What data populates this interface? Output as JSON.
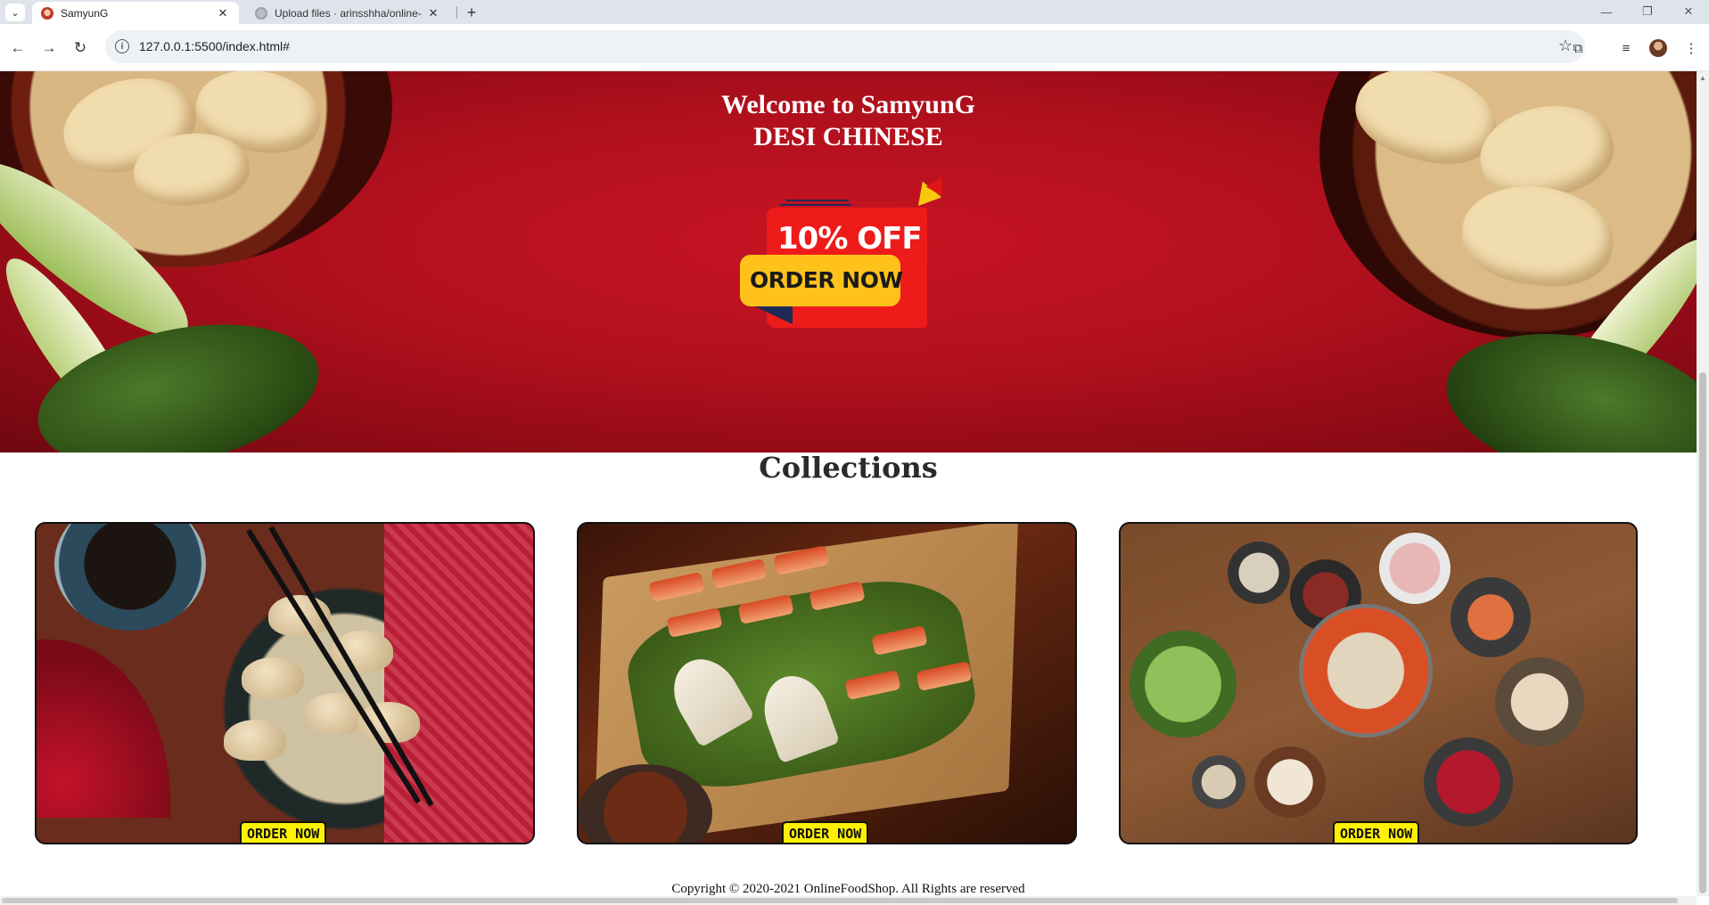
{
  "browser": {
    "tabs": [
      {
        "title": "SamyunG",
        "active": true
      },
      {
        "title": "Upload files · arinsshha/online-",
        "active": false
      }
    ],
    "url": "127.0.0.1:5500/index.html#"
  },
  "hero": {
    "line1": "Welcome to SamyunG",
    "line2": "DESI CHINESE",
    "promo_discount": "10% OFF",
    "promo_cta": "ORDER NOW"
  },
  "collections": {
    "title": "Collections",
    "cards": [
      {
        "dish_icon": "dumplings-image",
        "button_label": "ORDER NOW"
      },
      {
        "dish_icon": "peking-duck-image",
        "button_label": "ORDER NOW"
      },
      {
        "dish_icon": "hotpot-spread-image",
        "button_label": "ORDER NOW"
      }
    ]
  },
  "footer": {
    "copyright": "Copyright © 2020-2021 OnlineFoodShop. All Rights are reserved"
  },
  "colors": {
    "hero_red": "#c81423",
    "button_yellow": "#fff200",
    "promo_red": "#ee1b1b",
    "promo_yellow": "#ffc21a"
  }
}
